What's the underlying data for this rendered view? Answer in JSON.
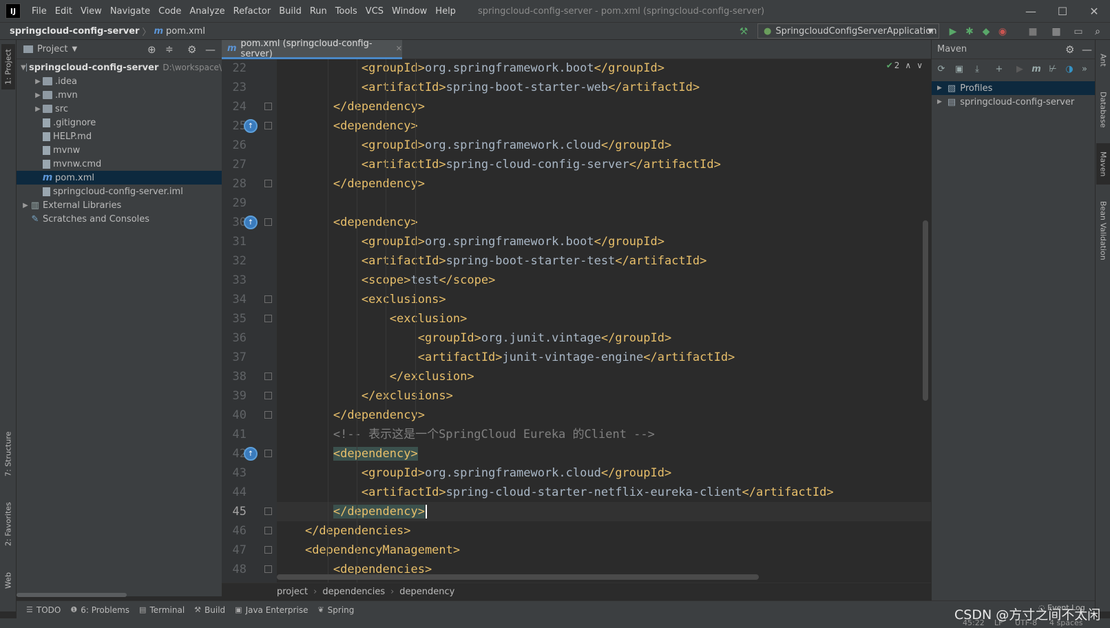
{
  "window": {
    "title": "springcloud-config-server - pom.xml (springcloud-config-server)",
    "logo": "IJ",
    "minimize": "—",
    "maximize": "☐",
    "close": "✕"
  },
  "menu": [
    "File",
    "Edit",
    "View",
    "Navigate",
    "Code",
    "Analyze",
    "Refactor",
    "Build",
    "Run",
    "Tools",
    "VCS",
    "Window",
    "Help"
  ],
  "navbar": {
    "project": "springcloud-config-server",
    "file_icon": "m",
    "file": "pom.xml",
    "run_config": "SpringcloudConfigServerApplication"
  },
  "left_strip": {
    "project": "1: Project",
    "structure": "7: Structure",
    "favorites": "2: Favorites",
    "web": "Web"
  },
  "project_panel": {
    "header": "Project",
    "tree": [
      {
        "label": "springcloud-config-server",
        "path": "D:\\workspace\\",
        "icon": "module-folder-icon"
      },
      {
        "label": ".idea",
        "icon": "folder-icon"
      },
      {
        "label": ".mvn",
        "icon": "folder-icon"
      },
      {
        "label": "src",
        "icon": "folder-icon"
      },
      {
        "label": ".gitignore",
        "icon": "gitignore-file-icon"
      },
      {
        "label": "HELP.md",
        "icon": "markdown-file-icon"
      },
      {
        "label": "mvnw",
        "icon": "script-file-icon"
      },
      {
        "label": "mvnw.cmd",
        "icon": "cmd-file-icon"
      },
      {
        "label": "pom.xml",
        "icon": "maven-file-icon"
      },
      {
        "label": "springcloud-config-server.iml",
        "icon": "iml-file-icon"
      },
      {
        "label": "External Libraries",
        "icon": "libraries-icon"
      },
      {
        "label": "Scratches and Consoles",
        "icon": "scratches-icon"
      }
    ]
  },
  "editor": {
    "tab_icon": "m",
    "tab_label": "pom.xml (springcloud-config-server)",
    "inspection_count": "2",
    "lines": [
      {
        "n": "22",
        "indent": "            ",
        "html": [
          [
            "tag",
            "<groupId>"
          ],
          [
            "txt",
            "org.springframework.boot"
          ],
          [
            "tag",
            "</groupId>"
          ]
        ]
      },
      {
        "n": "23",
        "indent": "            ",
        "html": [
          [
            "tag",
            "<artifactId>"
          ],
          [
            "txt",
            "spring-boot-starter-web"
          ],
          [
            "tag",
            "</artifactId>"
          ]
        ]
      },
      {
        "n": "24",
        "indent": "        ",
        "html": [
          [
            "tag",
            "</dependency>"
          ]
        ]
      },
      {
        "n": "25",
        "indent": "        ",
        "html": [
          [
            "tag",
            "<dependency>"
          ]
        ]
      },
      {
        "n": "26",
        "indent": "            ",
        "html": [
          [
            "tag",
            "<groupId>"
          ],
          [
            "txt",
            "org.springframework.cloud"
          ],
          [
            "tag",
            "</groupId>"
          ]
        ]
      },
      {
        "n": "27",
        "indent": "            ",
        "html": [
          [
            "tag",
            "<artifactId>"
          ],
          [
            "txt",
            "spring-cloud-config-server"
          ],
          [
            "tag",
            "</artifactId>"
          ]
        ]
      },
      {
        "n": "28",
        "indent": "        ",
        "html": [
          [
            "tag",
            "</dependency>"
          ]
        ]
      },
      {
        "n": "29",
        "indent": "",
        "html": []
      },
      {
        "n": "30",
        "indent": "        ",
        "html": [
          [
            "tag",
            "<dependency>"
          ]
        ]
      },
      {
        "n": "31",
        "indent": "            ",
        "html": [
          [
            "tag",
            "<groupId>"
          ],
          [
            "txt",
            "org.springframework.boot"
          ],
          [
            "tag",
            "</groupId>"
          ]
        ]
      },
      {
        "n": "32",
        "indent": "            ",
        "html": [
          [
            "tag",
            "<artifactId>"
          ],
          [
            "txt",
            "spring-boot-starter-test"
          ],
          [
            "tag",
            "</artifactId>"
          ]
        ]
      },
      {
        "n": "33",
        "indent": "            ",
        "html": [
          [
            "tag",
            "<scope>"
          ],
          [
            "txt",
            "test"
          ],
          [
            "tag",
            "</scope>"
          ]
        ]
      },
      {
        "n": "34",
        "indent": "            ",
        "html": [
          [
            "tag",
            "<exclusions>"
          ]
        ]
      },
      {
        "n": "35",
        "indent": "                ",
        "html": [
          [
            "tag",
            "<exclusion>"
          ]
        ]
      },
      {
        "n": "36",
        "indent": "                    ",
        "html": [
          [
            "tag",
            "<groupId>"
          ],
          [
            "txt",
            "org.junit.vintage"
          ],
          [
            "tag",
            "</groupId>"
          ]
        ]
      },
      {
        "n": "37",
        "indent": "                    ",
        "html": [
          [
            "tag",
            "<artifactId>"
          ],
          [
            "txt",
            "junit-vintage-engine"
          ],
          [
            "tag",
            "</artifactId>"
          ]
        ]
      },
      {
        "n": "38",
        "indent": "                ",
        "html": [
          [
            "tag",
            "</exclusion>"
          ]
        ]
      },
      {
        "n": "39",
        "indent": "            ",
        "html": [
          [
            "tag",
            "</exclusions>"
          ]
        ]
      },
      {
        "n": "40",
        "indent": "        ",
        "html": [
          [
            "tag",
            "</dependency>"
          ]
        ]
      },
      {
        "n": "41",
        "indent": "        ",
        "html": [
          [
            "cmt",
            "<!-- 表示这是一个SpringCloud Eureka 的Client -->"
          ]
        ]
      },
      {
        "n": "42",
        "indent": "        ",
        "html": [
          [
            "tag hl",
            "<dependency>"
          ]
        ]
      },
      {
        "n": "43",
        "indent": "            ",
        "html": [
          [
            "tag",
            "<groupId>"
          ],
          [
            "txt",
            "org.springframework.cloud"
          ],
          [
            "tag",
            "</groupId>"
          ]
        ]
      },
      {
        "n": "44",
        "indent": "            ",
        "html": [
          [
            "tag",
            "<artifactId>"
          ],
          [
            "txt",
            "spring-cloud-starter-netflix-eureka-client"
          ],
          [
            "tag",
            "</artifactId>"
          ]
        ]
      },
      {
        "n": "45",
        "indent": "        ",
        "html": [
          [
            "tag hl",
            "</dependency>"
          ]
        ]
      },
      {
        "n": "46",
        "indent": "    ",
        "html": [
          [
            "tag",
            "</dependencies>"
          ]
        ]
      },
      {
        "n": "47",
        "indent": "    ",
        "html": [
          [
            "tag",
            "<dependencyManagement>"
          ]
        ]
      },
      {
        "n": "48",
        "indent": "        ",
        "html": [
          [
            "tag",
            "<dependencies>"
          ]
        ]
      }
    ],
    "breadcrumb": [
      "project",
      "dependencies",
      "dependency"
    ]
  },
  "maven": {
    "title": "Maven",
    "items": [
      {
        "label": "Profiles",
        "icon": "profiles-icon"
      },
      {
        "label": "springcloud-config-server",
        "icon": "maven-module-icon"
      }
    ]
  },
  "right_strip": {
    "ant": "Ant",
    "database": "Database",
    "maven": "Maven",
    "bean": "Bean Validation"
  },
  "bottom_tools": [
    {
      "label": "TODO",
      "icon": "list-icon"
    },
    {
      "label": "6: Problems",
      "icon": "problems-icon"
    },
    {
      "label": "Terminal",
      "icon": "terminal-icon"
    },
    {
      "label": "Build",
      "icon": "hammer-icon"
    },
    {
      "label": "Java Enterprise",
      "icon": "java-enterprise-icon"
    },
    {
      "label": "Spring",
      "icon": "spring-icon"
    }
  ],
  "event_log": "Event Log",
  "status": {
    "position": "45:22",
    "line_sep": "LF",
    "encoding": "UTF-8",
    "indent": "4 spaces"
  },
  "watermark": "CSDN @方寸之间不太闲",
  "colors": {
    "accent": "#4a88c7",
    "tag": "#e8bf6a",
    "text": "#a9b7c6",
    "comment": "#808080",
    "run": "#59a869"
  }
}
